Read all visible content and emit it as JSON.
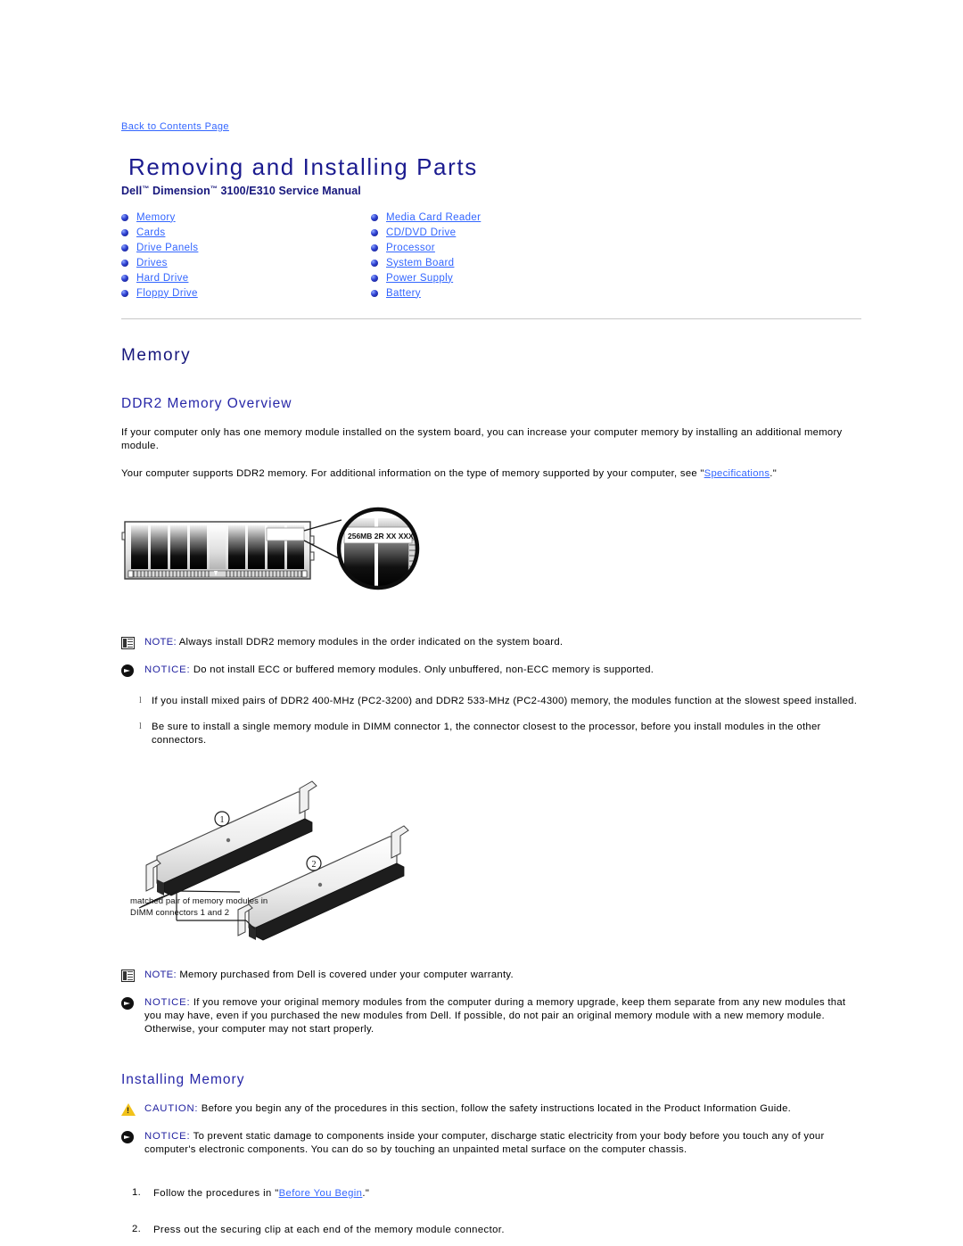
{
  "back_link": "Back to Contents Page",
  "title": "Removing and Installing Parts",
  "subtitle_pre": "Dell",
  "subtitle_tm1": "™",
  "subtitle_mid": " Dimension",
  "subtitle_tm2": "™",
  "subtitle_post": " 3100/E310 Service Manual",
  "nav": {
    "left": [
      {
        "label": "Memory"
      },
      {
        "label": "Cards"
      },
      {
        "label": "Drive Panels"
      },
      {
        "label": "Drives"
      },
      {
        "label": "Hard Drive"
      },
      {
        "label": "Floppy Drive"
      }
    ],
    "right": [
      {
        "label": "Media Card Reader"
      },
      {
        "label": "CD/DVD Drive"
      },
      {
        "label": "Processor"
      },
      {
        "label": "System Board"
      },
      {
        "label": "Power Supply"
      },
      {
        "label": "Battery"
      }
    ]
  },
  "memory_heading": "Memory",
  "ddr2_heading": "DDR2 Memory Overview",
  "para1": "If your computer only has one memory module installed on the system board, you can increase your computer memory by installing an additional memory module.",
  "para2_pre": "Your computer supports DDR2 memory. For additional information on the type of memory supported by your computer, see \"",
  "para2_link": "Specifications",
  "para2_post": ".\"",
  "fig1": {
    "module_label": "256MB 2R XX XXX"
  },
  "note1_label": "NOTE:",
  "note1_text": " Always install DDR2 memory modules in the order indicated on the system board.",
  "notice1_label": "NOTICE:",
  "notice1_text": " Do not install ECC or buffered memory modules. Only unbuffered, non-ECC memory is supported.",
  "subbullets": [
    {
      "mark": "l",
      "text": "If you install mixed pairs of DDR2 400-MHz (PC2-3200) and DDR2 533-MHz (PC2-4300) memory, the modules function at the slowest speed installed."
    },
    {
      "mark": "l",
      "text": "Be sure to install a single memory module in DIMM connector 1, the connector closest to the processor, before you install modules in the other connectors."
    }
  ],
  "fig2": {
    "callout_1": "1",
    "callout_2": "2",
    "caption": "matched pair of memory modules in DIMM connectors 1 and 2"
  },
  "note2_label": "NOTE:",
  "note2_text": " Memory purchased from Dell is covered under your computer warranty.",
  "notice2_label": "NOTICE:",
  "notice2_text": " If you remove your original memory modules from the computer during a memory upgrade, keep them separate from any new modules that you may have, even if you purchased the new modules from Dell. If possible, do not pair an original memory module with a new memory module. Otherwise, your computer may not start properly.",
  "installing_heading": "Installing Memory",
  "caution_label": "CAUTION:",
  "caution_text": " Before you begin any of the procedures in this section, follow the safety instructions located in the Product Information Guide.",
  "notice3_label": "NOTICE:",
  "notice3_text": " To prevent static damage to components inside your computer, discharge static electricity from your body before you touch any of your computer's electronic components. You can do so by touching an unpainted metal surface on the computer chassis.",
  "steps": [
    {
      "num": "1.",
      "pre": "Follow the procedures in \"",
      "link": "Before You Begin",
      "post": ".\""
    },
    {
      "num": "2.",
      "pre": "Press out the securing clip at each end of the memory module connector.",
      "link": "",
      "post": ""
    }
  ],
  "colors": {
    "link": "#3366ff",
    "title": "#1b1b8f",
    "heading": "#16167c",
    "subheading": "#2727a8",
    "caution_icon": "#f2c21a",
    "rule": "#c8c8c8"
  }
}
